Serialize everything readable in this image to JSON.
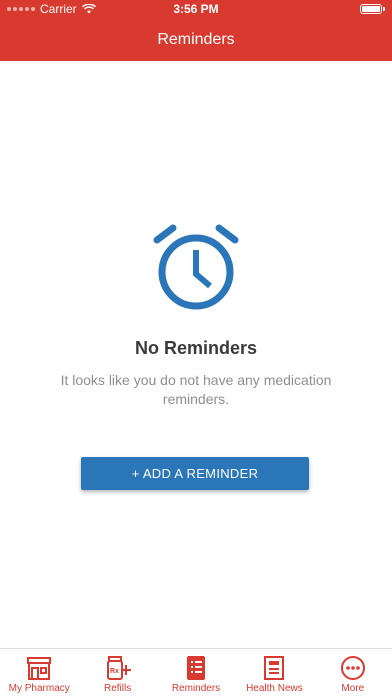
{
  "status_bar": {
    "carrier": "Carrier",
    "time": "3:56 PM"
  },
  "header": {
    "title": "Reminders"
  },
  "empty_state": {
    "icon": "alarm-clock-icon",
    "title": "No Reminders",
    "description": "It looks like you do not have any medication reminders."
  },
  "add_button": {
    "label": "+ ADD A REMINDER"
  },
  "tabs": [
    {
      "label": "My Pharmacy",
      "icon": "pharmacy-store-icon"
    },
    {
      "label": "Refills",
      "icon": "rx-refill-icon"
    },
    {
      "label": "Reminders",
      "icon": "reminders-list-icon",
      "active": true
    },
    {
      "label": "Health News",
      "icon": "newspaper-icon"
    },
    {
      "label": "More",
      "icon": "more-dots-icon"
    }
  ],
  "colors": {
    "brand_red": "#d93a30",
    "accent_blue": "#2a76b9"
  }
}
